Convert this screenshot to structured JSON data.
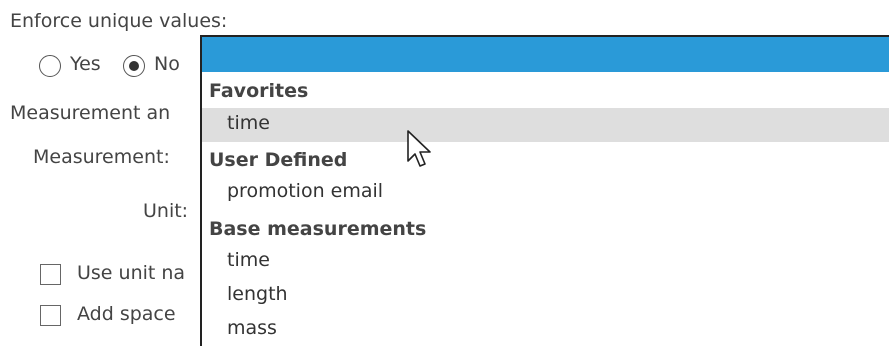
{
  "form": {
    "enforce_unique_label": "Enforce unique values:",
    "radio_yes_label": "Yes",
    "radio_no_label": "No",
    "selected_option": "No",
    "measurement_section_label": "Measurement an",
    "measurement_label": "Measurement:",
    "unit_label": "Unit:",
    "use_unit_label": "Use unit na",
    "add_space_label": "Add space"
  },
  "dropdown": {
    "groups": [
      {
        "label": "Favorites",
        "items": [
          "time"
        ]
      },
      {
        "label": "User Defined",
        "items": [
          "promotion email"
        ]
      },
      {
        "label": "Base measurements",
        "items": [
          "time",
          "length",
          "mass"
        ]
      }
    ],
    "hovered_item": "time",
    "header_color": "#2a9ad8"
  }
}
